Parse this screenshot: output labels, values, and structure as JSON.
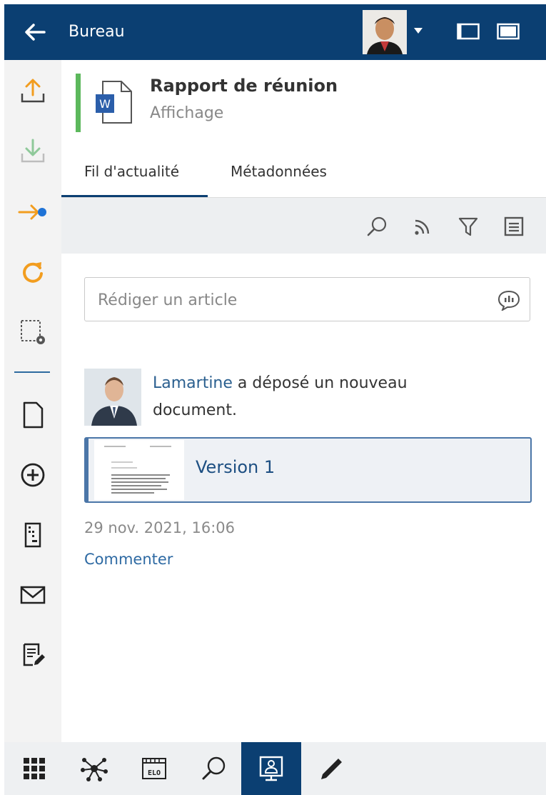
{
  "header": {
    "title": "Bureau",
    "icons": {
      "back": "arrow-left-icon",
      "profile_dropdown": "caret-down-icon",
      "panel_left": "panel-left-icon",
      "panel_full": "panel-full-icon"
    }
  },
  "sidebar": {
    "items": [
      {
        "icon": "upload-icon"
      },
      {
        "icon": "download-icon"
      },
      {
        "icon": "arrow-dot-icon"
      },
      {
        "icon": "refresh-icon"
      },
      {
        "icon": "selection-settings-icon"
      },
      {
        "icon": "new-document-icon"
      },
      {
        "icon": "add-circle-icon"
      },
      {
        "icon": "binder-icon"
      },
      {
        "icon": "mail-icon"
      },
      {
        "icon": "edit-document-icon"
      }
    ]
  },
  "document": {
    "title": "Rapport de réunion",
    "subtitle": "Affichage",
    "icon_letter": "W",
    "status_color": "#5cb85c"
  },
  "tabs": [
    {
      "label": "Fil d'actualité",
      "active": true
    },
    {
      "label": "Métadonnées",
      "active": false
    }
  ],
  "toolbar": {
    "icons": [
      "search-icon",
      "rss-icon",
      "filter-icon",
      "list-icon"
    ]
  },
  "compose": {
    "placeholder": "Rédiger un article"
  },
  "feed": {
    "user": "Lamartine",
    "action": " a déposé un nouveau document.",
    "version_label": "Version 1",
    "timestamp": "29 nov. 2021, 16:06",
    "comment_label": "Commenter"
  },
  "bottombar": {
    "items": [
      {
        "icon": "apps-grid-icon",
        "active": false
      },
      {
        "icon": "network-icon",
        "active": false
      },
      {
        "icon": "elo-archive-icon",
        "active": false,
        "text": "ELO"
      },
      {
        "icon": "search-icon",
        "active": false
      },
      {
        "icon": "desktop-user-icon",
        "active": true
      },
      {
        "icon": "pen-icon",
        "active": false
      }
    ]
  },
  "colors": {
    "primary": "#0b3f72",
    "accent_orange": "#f29d1f",
    "link": "#2e6aa3"
  }
}
